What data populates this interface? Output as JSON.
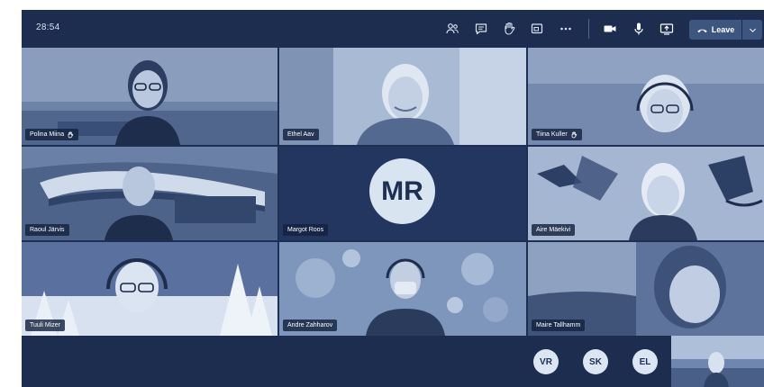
{
  "window": {
    "timer": "28:54",
    "leave_label": "Leave",
    "accent": "#3d5680",
    "background": "#1d2f53"
  },
  "toolbar": {
    "icons": [
      "people-icon",
      "chat-icon",
      "raise-hand-icon",
      "share-tray-icon",
      "more-icon",
      "camera-icon",
      "microphone-icon",
      "share-screen-icon",
      "phone-leave-icon",
      "chevron-down-icon"
    ]
  },
  "participants": [
    {
      "name": "Polina Miina",
      "raised_hand": true
    },
    {
      "name": "Ethel Aav",
      "raised_hand": false
    },
    {
      "name": "Tiina Kuller",
      "raised_hand": true
    },
    {
      "name": "Raoul Järvis",
      "raised_hand": false
    },
    {
      "name": "Margot Roos",
      "initials": "MR",
      "raised_hand": false
    },
    {
      "name": "Aire Mäekivi",
      "raised_hand": false
    },
    {
      "name": "Tuuli Mizer",
      "raised_hand": false
    },
    {
      "name": "Andre Zahharov",
      "raised_hand": false
    },
    {
      "name": "Maire Tallhamm",
      "raised_hand": false
    }
  ],
  "overflow_avatars": [
    "VR",
    "SK",
    "EL"
  ]
}
